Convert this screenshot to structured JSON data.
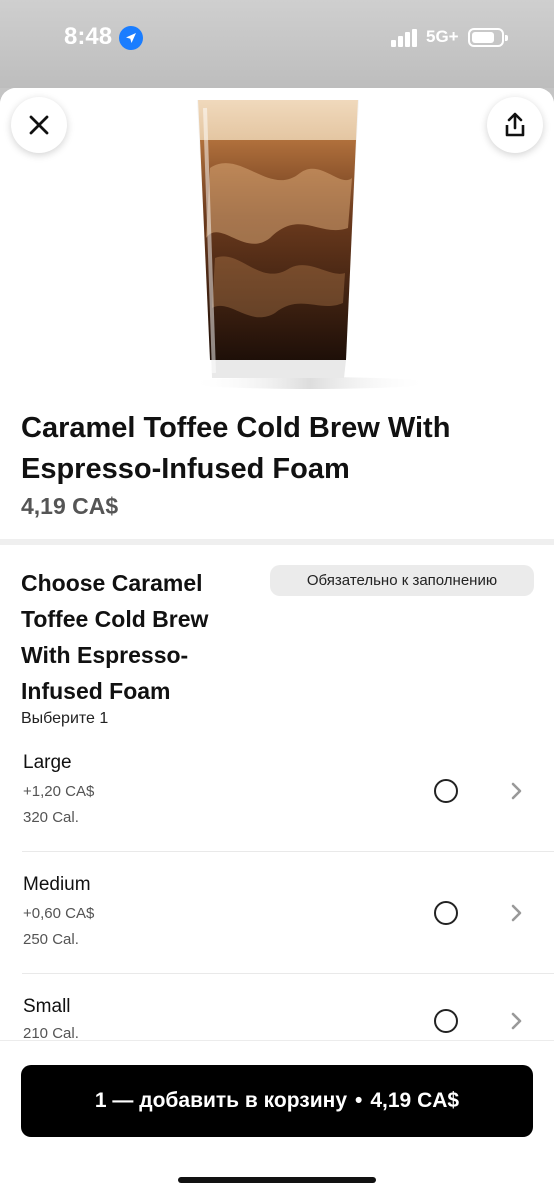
{
  "status_bar": {
    "time": "8:48",
    "network": "5G+",
    "icons": [
      "location-arrow-icon",
      "signal-icon",
      "battery-icon"
    ]
  },
  "header": {
    "close_icon": "close-icon",
    "share_icon": "share-icon"
  },
  "product": {
    "title": "Caramel Toffee Cold Brew With Espresso-Infused Foam",
    "price": "4,19 CA$"
  },
  "option_group": {
    "title": "Choose Caramel Toffee Cold Brew With Espresso-Infused Foam",
    "required_label": "Обязательно к заполнению",
    "hint": "Выберите 1",
    "options": [
      {
        "name": "Large",
        "price": "+1,20 CA$",
        "calories": "320 Cal."
      },
      {
        "name": "Medium",
        "price": "+0,60 CA$",
        "calories": "250 Cal."
      },
      {
        "name": "Small",
        "calories": "210 Cal."
      }
    ]
  },
  "cta": {
    "label": "1 — добавить в корзину",
    "separator": "•",
    "price": "4,19 CA$"
  },
  "colors": {
    "accent": "#000000",
    "status_location": "#1a7dff"
  }
}
